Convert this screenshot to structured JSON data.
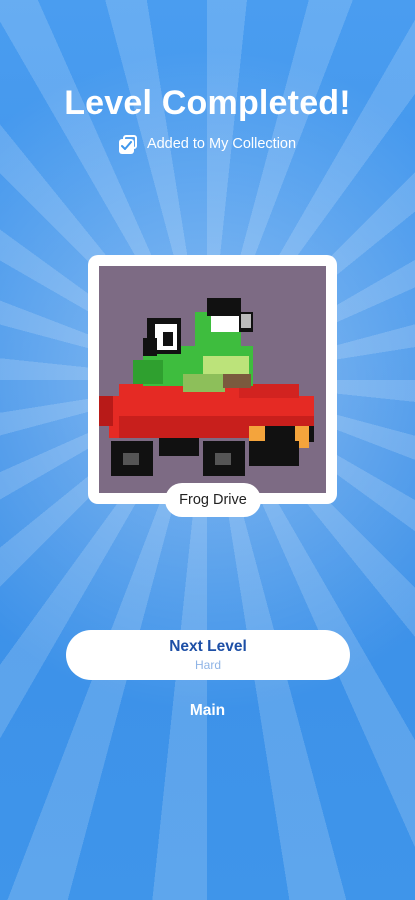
{
  "header": {
    "title": "Level Completed!",
    "collection_text": "Added to My Collection"
  },
  "puzzle": {
    "name": "Frog Drive",
    "image_subject": "pixel-art frog driving a red car",
    "background_color": "#7d6b84"
  },
  "actions": {
    "next_label": "Next Level",
    "next_difficulty": "Hard",
    "main_label": "Main"
  },
  "colors": {
    "background": "#3f97ec",
    "accent_text": "#1d4fa6",
    "frog_green": "#3ebd3e",
    "car_red": "#e52a24"
  }
}
